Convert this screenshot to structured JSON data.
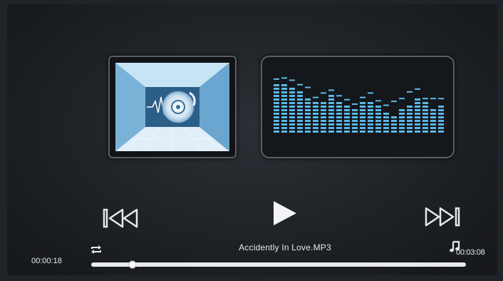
{
  "player": {
    "track_title": "Accidently In Love.MP3",
    "elapsed": "00:00:18",
    "total": "00:03:08",
    "progress": 0.11
  },
  "icons": {
    "album_art": "disc-music-icon",
    "previous": "skip-previous-icon",
    "play": "play-icon",
    "next": "skip-next-icon",
    "repeat": "repeat-icon",
    "note": "music-note-icon"
  },
  "equalizer": {
    "levels": [
      0.9,
      0.9,
      0.85,
      0.8,
      0.65,
      0.6,
      0.55,
      0.7,
      0.6,
      0.5,
      0.45,
      0.55,
      0.6,
      0.5,
      0.4,
      0.35,
      0.45,
      0.5,
      0.65,
      0.55,
      0.45,
      0.5
    ],
    "peaks": [
      0.95,
      0.97,
      0.93,
      0.85,
      0.8,
      0.62,
      0.7,
      0.75,
      0.65,
      0.58,
      0.5,
      0.62,
      0.7,
      0.56,
      0.48,
      0.55,
      0.6,
      0.72,
      0.77,
      0.6,
      0.6,
      0.6
    ]
  },
  "colors": {
    "accent": "#5bb8e8",
    "foreground": "#e8eaec"
  }
}
